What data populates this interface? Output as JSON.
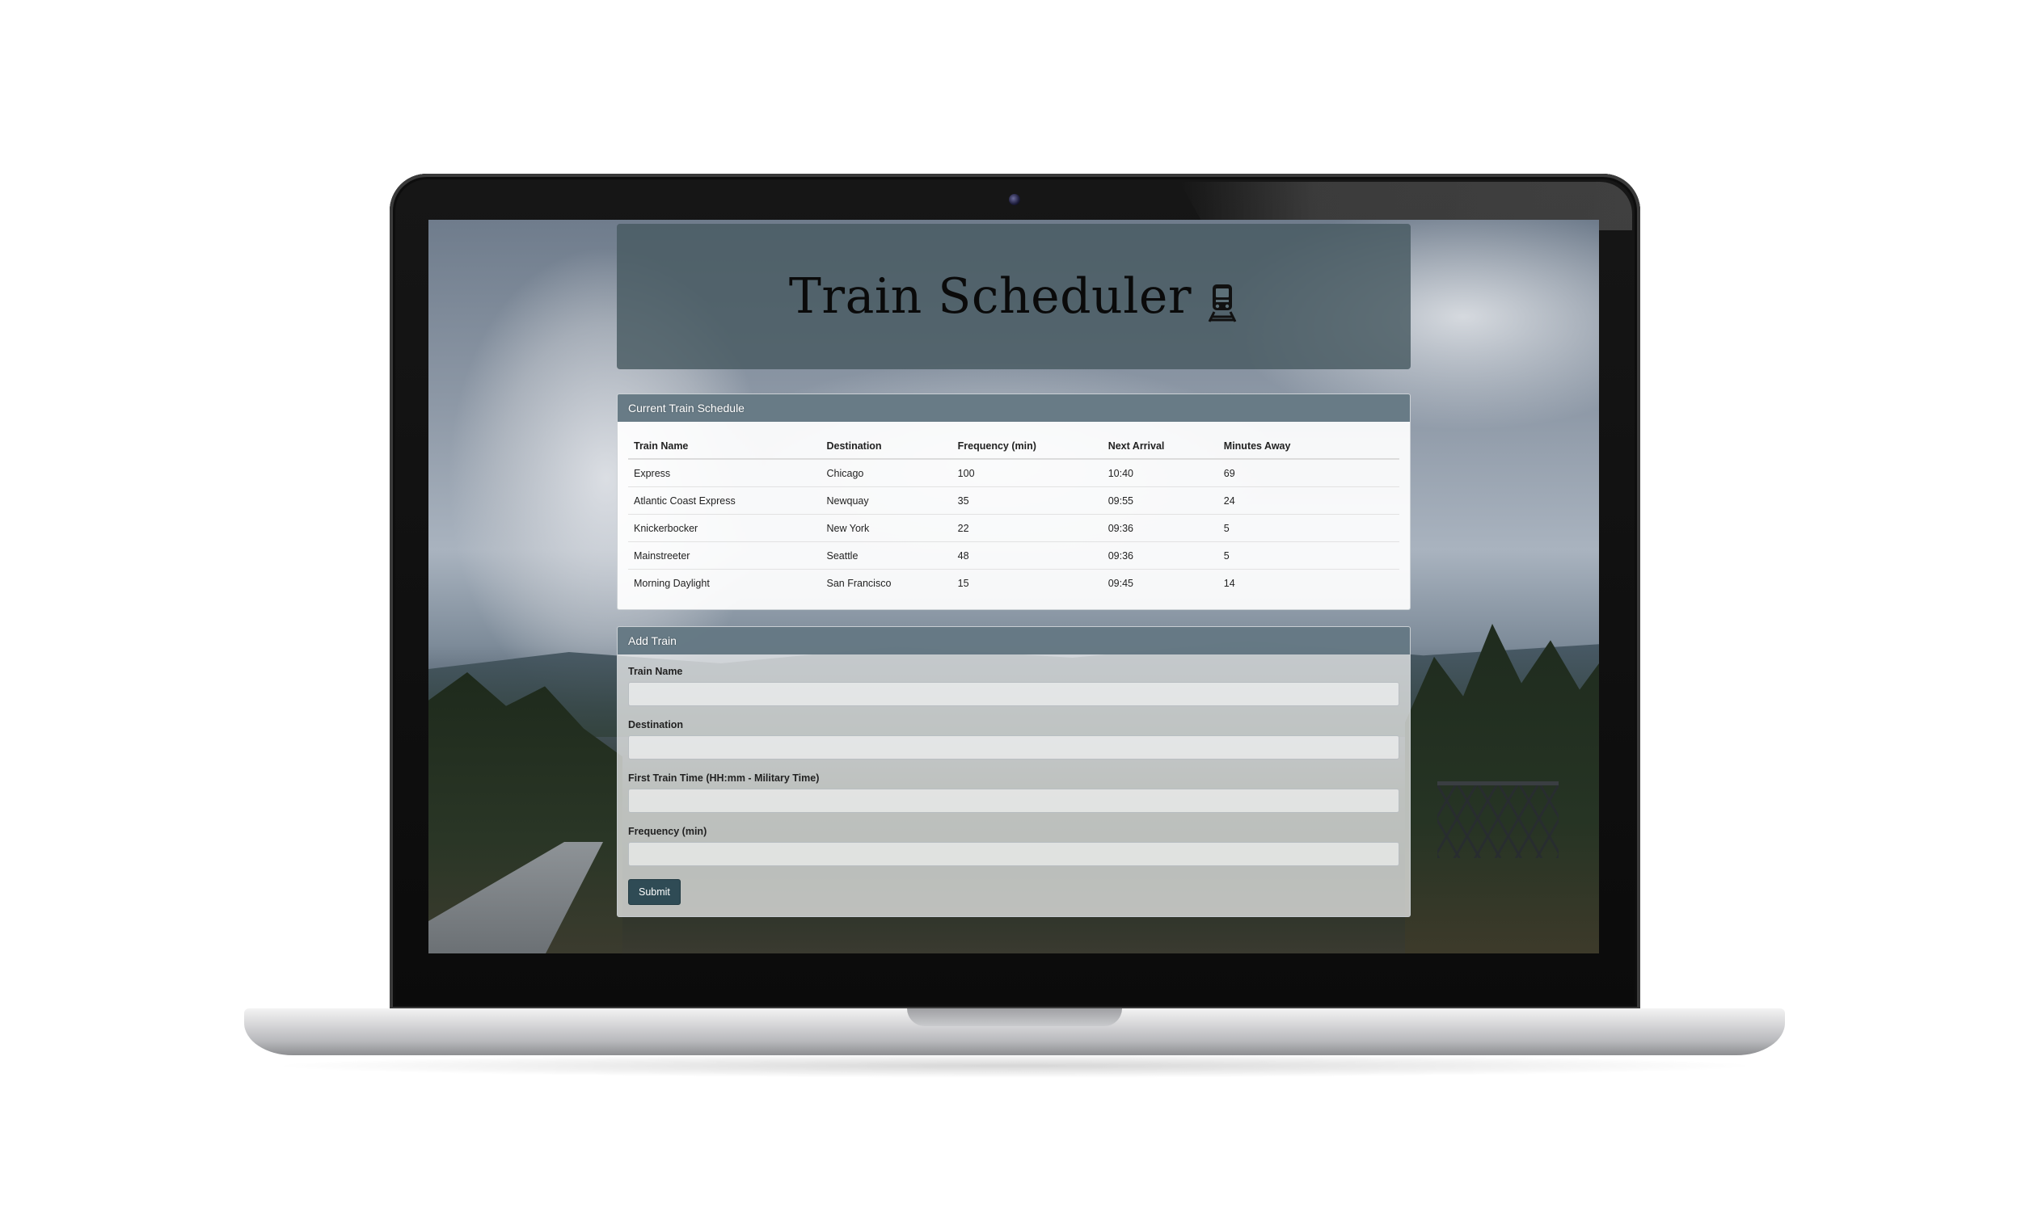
{
  "header": {
    "title": "Train Scheduler",
    "icon": "train-icon"
  },
  "schedule": {
    "heading": "Current Train Schedule",
    "columns": [
      "Train Name",
      "Destination",
      "Frequency (min)",
      "Next Arrival",
      "Minutes Away"
    ],
    "rows": [
      [
        "Express",
        "Chicago",
        "100",
        "10:40",
        "69"
      ],
      [
        "Atlantic Coast Express",
        "Newquay",
        "35",
        "09:55",
        "24"
      ],
      [
        "Knickerbocker",
        "New York",
        "22",
        "09:36",
        "5"
      ],
      [
        "Mainstreeter",
        "Seattle",
        "48",
        "09:36",
        "5"
      ],
      [
        "Morning Daylight",
        "San Francisco",
        "15",
        "09:45",
        "14"
      ]
    ]
  },
  "add_train": {
    "heading": "Add Train",
    "fields": {
      "train_name": {
        "label": "Train Name",
        "value": ""
      },
      "destination": {
        "label": "Destination",
        "value": ""
      },
      "first_time": {
        "label": "First Train Time (HH:mm - Military Time)",
        "value": ""
      },
      "frequency": {
        "label": "Frequency (min)",
        "value": ""
      }
    },
    "submit_label": "Submit"
  },
  "colors": {
    "jumbotron": "#485a62",
    "panel_heading": "#607480",
    "submit_button": "#2f4b55"
  }
}
